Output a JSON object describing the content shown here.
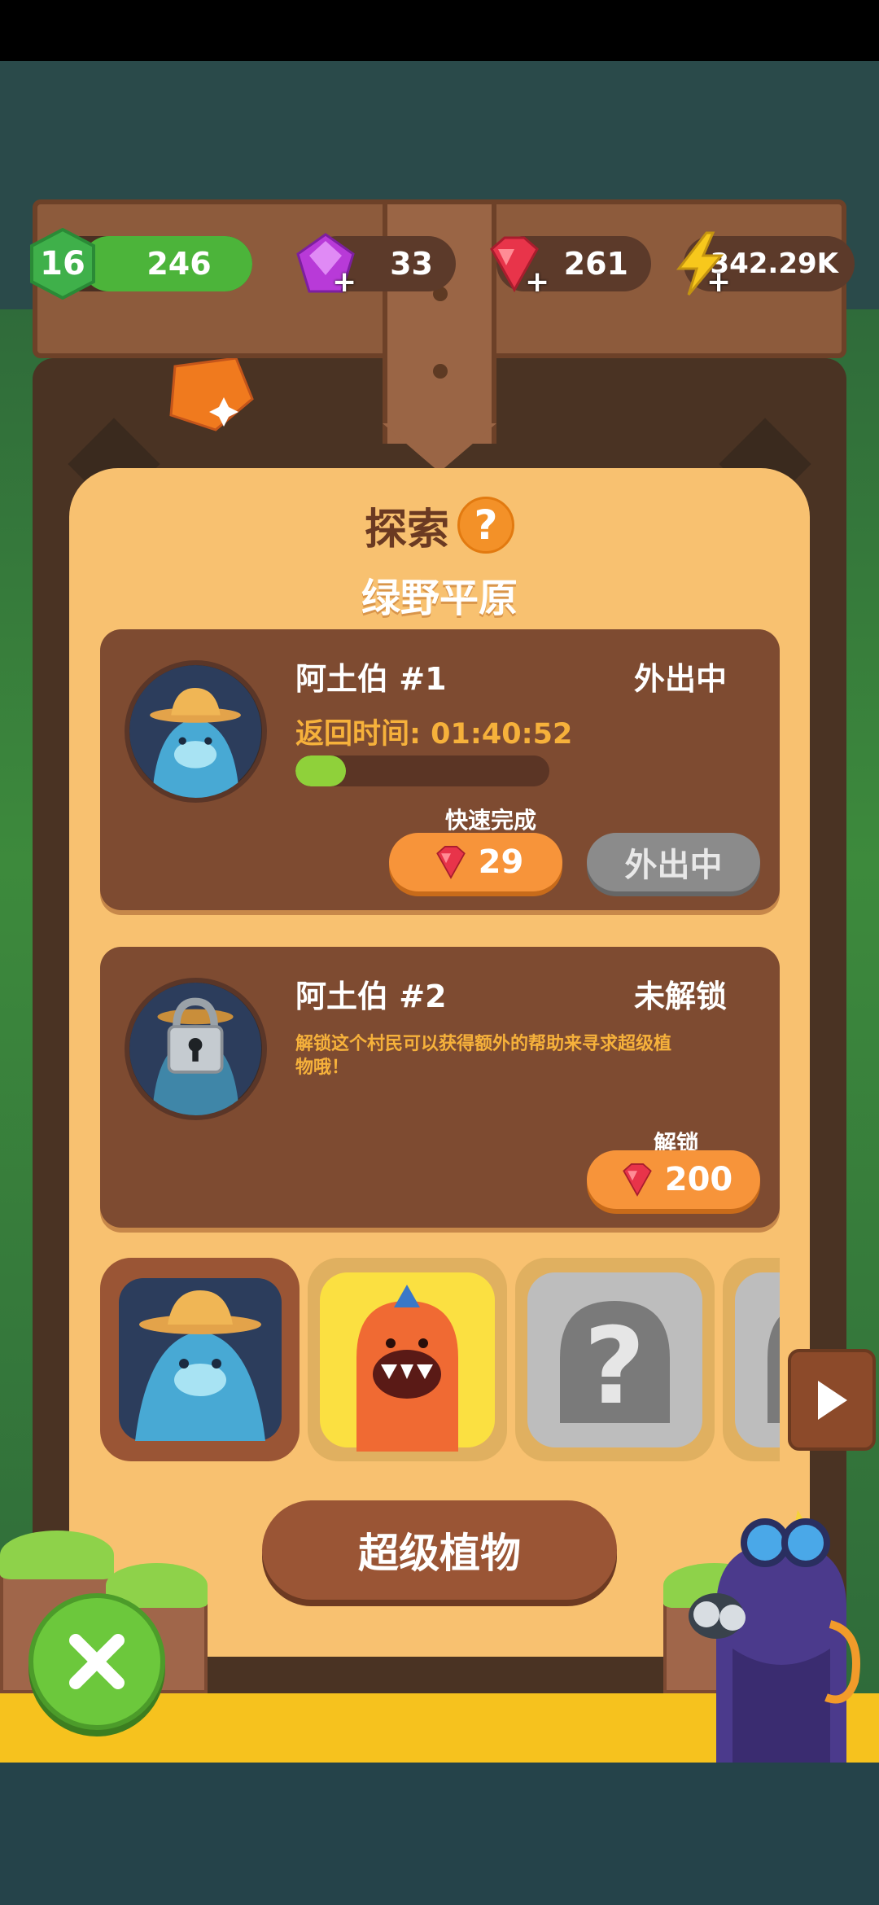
{
  "currency": {
    "level": "16",
    "xp": "246",
    "purple_gems": "33",
    "red_gems": "261",
    "energy": "342.29K"
  },
  "panel": {
    "title": "探索",
    "help_label": "?",
    "area_name": "绿野平原"
  },
  "explorers": [
    {
      "name": "阿土伯 #1",
      "status": "外出中",
      "return_time": "返回时间: 01:40:52",
      "progress": 0.2,
      "quick_label": "快速完成",
      "quick_cost": "29",
      "status_button": "外出中"
    },
    {
      "name": "阿土伯 #2",
      "status": "未解锁",
      "description": "解锁这个村民可以获得额外的帮助来寻求超级植物哦！",
      "unlock_label": "解锁",
      "unlock_cost": "200"
    }
  ],
  "roster": {
    "unknown_symbol": "?"
  },
  "super_plants_button": "超级植物",
  "colors": {
    "panel": "#f8c170",
    "card": "#7e4b31",
    "accent_orange": "#f7943a",
    "progress_green": "#8fd13a",
    "close_green": "#6cc83c"
  }
}
